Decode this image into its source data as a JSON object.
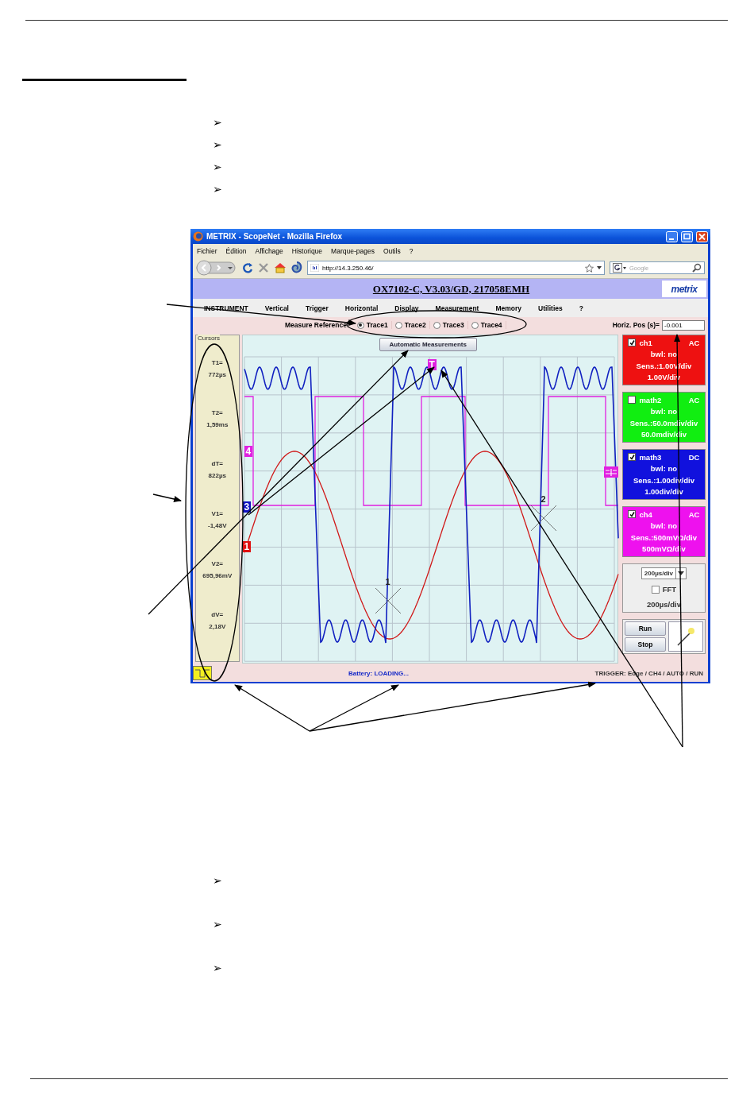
{
  "page": {
    "top_bullets": [
      "➢",
      "➢",
      "➢",
      "➢"
    ],
    "bottom_bullets": [
      "➢",
      "➢",
      "➢"
    ]
  },
  "browser": {
    "title": "METRIX - ScopeNet - Mozilla Firefox",
    "menu": [
      "Fichier",
      "Édition",
      "Affichage",
      "Historique",
      "Marque-pages",
      "Outils",
      "?"
    ],
    "url": "http://14.3.250.46/",
    "search": {
      "placeholder": "Google"
    }
  },
  "app": {
    "title": "OX7102-C, V3.03/GD, 217058EMH",
    "logo": "metrix",
    "menu": [
      "INSTRUMENT",
      "Vertical",
      "Trigger",
      "Horizontal",
      "Display",
      "Measurement",
      "Memory",
      "Utilities",
      "?"
    ],
    "measure_reference": {
      "label": "Measure Reference:",
      "options": [
        {
          "label": "Trace1",
          "selected": true
        },
        {
          "label": "Trace2",
          "selected": false
        },
        {
          "label": "Trace3",
          "selected": false
        },
        {
          "label": "Trace4",
          "selected": false
        }
      ]
    },
    "horiz_pos": {
      "label": "Horiz. Pos (s)=",
      "value": "-0.001"
    },
    "automatic_measurements_button": "Automatic Measurements",
    "cursors": {
      "title": "Cursors",
      "items": [
        {
          "label": "T1=",
          "value": "772µs"
        },
        {
          "label": "T2=",
          "value": "1,59ms"
        },
        {
          "label": "dT=",
          "value": "822µs"
        },
        {
          "label": "V1=",
          "value": "-1,48V"
        },
        {
          "label": "V2=",
          "value": "695,96mV"
        },
        {
          "label": "dV=",
          "value": "2,18V"
        }
      ]
    },
    "plot_markers": [
      {
        "text": "4",
        "color": "#e020e0"
      },
      {
        "text": "3",
        "color": "#1010c0"
      },
      {
        "text": "1",
        "color": "#e01010"
      },
      {
        "text": "T",
        "color": "#e020e0"
      }
    ],
    "cursor_marks": [
      "1",
      "2"
    ],
    "channels": [
      {
        "name": "ch1",
        "checked": true,
        "coupling": "AC",
        "bwl": "bwl: no",
        "sensitivity": "Sens.:1.00V/div",
        "scale": "1.00V/div",
        "color": "#ee1111"
      },
      {
        "name": "math2",
        "checked": false,
        "coupling": "AC",
        "bwl": "bwl: no",
        "sensitivity": "Sens.:50.0mdiv/div",
        "scale": "50.0mdiv/div",
        "color": "#11ee11"
      },
      {
        "name": "math3",
        "checked": true,
        "coupling": "DC",
        "bwl": "bwl: no",
        "sensitivity": "Sens.:1.00div/div",
        "scale": "1.00div/div",
        "color": "#1111dd"
      },
      {
        "name": "ch4",
        "checked": true,
        "coupling": "AC",
        "bwl": "bwl: no",
        "sensitivity": "Sens.:500mVΩ/div",
        "scale": "500mVΩ/div",
        "color": "#ee11ee"
      }
    ],
    "timebase": {
      "value": "200µs/div",
      "fft": {
        "label": "FFT",
        "checked": false
      },
      "reading": "200µs/div"
    },
    "buttons": [
      "Run",
      "Stop"
    ],
    "status": {
      "battery": "Battery: LOADING...",
      "trigger": "TRIGGER: Edge / CH4 / AUTO / RUN"
    }
  }
}
